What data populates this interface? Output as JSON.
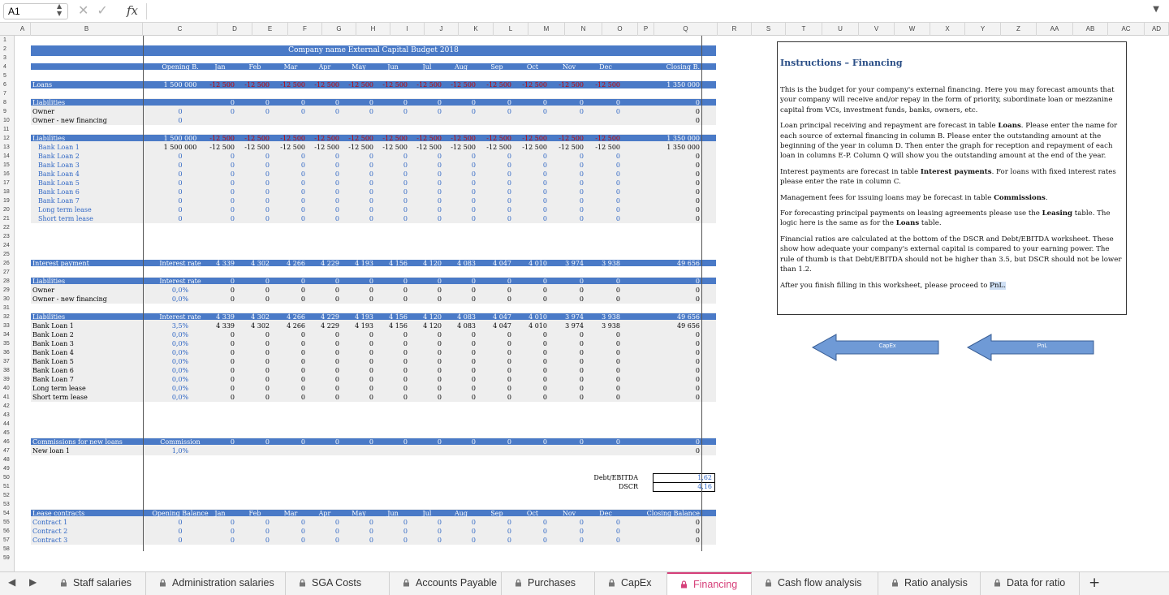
{
  "formula_bar": {
    "name_box": "A1",
    "formula": ""
  },
  "columns": [
    "A",
    "B",
    "C",
    "D",
    "E",
    "F",
    "G",
    "H",
    "I",
    "J",
    "K",
    "L",
    "M",
    "N",
    "O",
    "P",
    "Q",
    "R",
    "S",
    "T",
    "U",
    "V",
    "W",
    "X",
    "Y",
    "Z",
    "AA",
    "AB",
    "AC",
    "AD"
  ],
  "rows": [
    "1",
    "2",
    "3",
    "4",
    "5",
    "6",
    "7",
    "8",
    "9",
    "10",
    "11",
    "12",
    "13",
    "14",
    "15",
    "16",
    "17",
    "18",
    "19",
    "20",
    "21",
    "22",
    "23",
    "24",
    "25",
    "26",
    "27",
    "28",
    "29",
    "30",
    "31",
    "32",
    "33",
    "34",
    "35",
    "36",
    "37",
    "38",
    "39",
    "40",
    "41",
    "42",
    "43",
    "44",
    "45",
    "46",
    "47",
    "48",
    "49",
    "50",
    "51",
    "52",
    "53",
    "54",
    "55",
    "56",
    "57",
    "58",
    "59"
  ],
  "title": "Company name External Capital Budget 2018",
  "months": [
    "Jan",
    "Feb",
    "Mar",
    "Apr",
    "May",
    "Jun",
    "Jul",
    "Aug",
    "Sep",
    "Oct",
    "Nov",
    "Dec"
  ],
  "head": {
    "opening": "Opening B.",
    "closing": "Closing B.",
    "interest_rate": "Interest rate",
    "commission": "Commission",
    "opening_balance": "Opening Balance",
    "closing_balance": "Closing Balance"
  },
  "loans": {
    "label": "Loans",
    "opening": "1 500 000",
    "monthly": "-12 500",
    "closing": "1 350 000"
  },
  "liab1": {
    "header": "Liabilities",
    "rows": [
      {
        "label": "Owner",
        "opening": "0",
        "closing": "0"
      },
      {
        "label": "Owner - new financing",
        "opening": "0",
        "closing": "0"
      }
    ]
  },
  "liab2": {
    "header": "Liabilities",
    "header_opening": "1 500 000",
    "header_closing": "1 350 000",
    "rows": [
      {
        "label": "Bank Loan 1",
        "opening": "1 500 000",
        "closing": "1 350 000"
      },
      {
        "label": "Bank Loan 2",
        "opening": "0",
        "closing": "0"
      },
      {
        "label": "Bank Loan 3",
        "opening": "0",
        "closing": "0"
      },
      {
        "label": "Bank Loan 4",
        "opening": "0",
        "closing": "0"
      },
      {
        "label": "Bank Loan 5",
        "opening": "0",
        "closing": "0"
      },
      {
        "label": "Bank Loan 6",
        "opening": "0",
        "closing": "0"
      },
      {
        "label": "Bank Loan 7",
        "opening": "0",
        "closing": "0"
      },
      {
        "label": "Long term lease",
        "opening": "0",
        "closing": "0"
      },
      {
        "label": "Short term lease",
        "opening": "0",
        "closing": "0"
      }
    ]
  },
  "interest": {
    "label": "Interest payment",
    "values": [
      "4 339",
      "4 302",
      "4 266",
      "4 229",
      "4 193",
      "4 156",
      "4 120",
      "4 083",
      "4 047",
      "4 010",
      "3 974",
      "3 938"
    ],
    "total": "49 656"
  },
  "liab3": {
    "header": "Liabilities",
    "rows": [
      {
        "label": "Owner",
        "rate": "0,0%",
        "total": "0"
      },
      {
        "label": "Owner - new financing",
        "rate": "0,0%",
        "total": "0"
      }
    ]
  },
  "liab4": {
    "header": "Liabilities",
    "rows": [
      {
        "label": "Bank Loan 1",
        "rate": "3,5%",
        "total": "49 656"
      },
      {
        "label": "Bank Loan 2",
        "rate": "0,0%",
        "total": "0"
      },
      {
        "label": "Bank Loan 3",
        "rate": "0,0%",
        "total": "0"
      },
      {
        "label": "Bank Loan 4",
        "rate": "0,0%",
        "total": "0"
      },
      {
        "label": "Bank Loan 5",
        "rate": "0,0%",
        "total": "0"
      },
      {
        "label": "Bank Loan 6",
        "rate": "0,0%",
        "total": "0"
      },
      {
        "label": "Bank Loan 7",
        "rate": "0,0%",
        "total": "0"
      },
      {
        "label": "Long term lease",
        "rate": "0,0%",
        "total": "0"
      },
      {
        "label": "Short term lease",
        "rate": "0,0%",
        "total": "0"
      }
    ]
  },
  "commissions": {
    "label": "Commissions for new loans",
    "row_label": "New loan 1",
    "rate": "1,0%",
    "total": "0"
  },
  "ratios": [
    {
      "label": "Debt/EBITDA",
      "value": "1,62"
    },
    {
      "label": "DSCR",
      "value": "4,16"
    }
  ],
  "lease": {
    "label": "Lease contracts",
    "rows": [
      {
        "label": "Contract 1"
      },
      {
        "label": "Contract 2"
      },
      {
        "label": "Contract 3"
      }
    ]
  },
  "zero": "0",
  "instructions": {
    "title": "Instructions – Financing",
    "p1": "This is the budget for your company's external financing. Here you may forecast amounts that your company will receive and/or repay in the form of priority, subordinate loan or mezzanine capital from VCs, investment funds, banks, owners, etc.",
    "p2a": "Loan principal receiving and repayment are forecast in table ",
    "p2b": "Loans",
    "p2c": ". Please enter the name for each source of external financing in column B. Please enter the outstanding amount at the beginning of the year in column D. Then enter the graph for reception and repayment of each loan in columns E-P. Column Q will show you the outstanding amount at the end of the year.",
    "p3a": "Interest payments are forecast in table ",
    "p3b": "Interest payments",
    "p3c": ". For loans with fixed interest rates please enter the rate in column C.",
    "p4a": "Management fees for issuing loans may be forecast in table ",
    "p4b": "Commissions",
    "p4c": ".",
    "p5a": "For forecasting principal payments on leasing agreements please use the ",
    "p5b": "Leasing",
    "p5c": " table. The logic here is the same as for the ",
    "p5d": "Loans",
    "p5e": " table.",
    "p6": "Financial ratios are calculated at the bottom of the DSCR and Debt/EBITDA worksheet. These show how adequate your company's external capital is compared to your earning power. The rule of thumb is that Debt/EBITDA should not be higher than 3.5, but DSCR should not be lower than 1.2.",
    "p7a": "After you finish filling in this worksheet, please proceed to ",
    "p7b": "PnL."
  },
  "buttons": {
    "capex": "CapEx",
    "pnl": "PnL"
  },
  "tabs": [
    "Staff salaries",
    "Administration salaries",
    "SGA Costs",
    "Accounts Payable",
    "Purchases",
    "CapEx",
    "Financing",
    "Cash flow analysis",
    "Ratio analysis",
    "Data for ratio"
  ],
  "active_tab": "Financing",
  "colors": {
    "header_blue": "#4a7ac7",
    "input_blue": "#2f66c4",
    "negative_red": "#c00000",
    "active_tab": "#d6407a"
  }
}
